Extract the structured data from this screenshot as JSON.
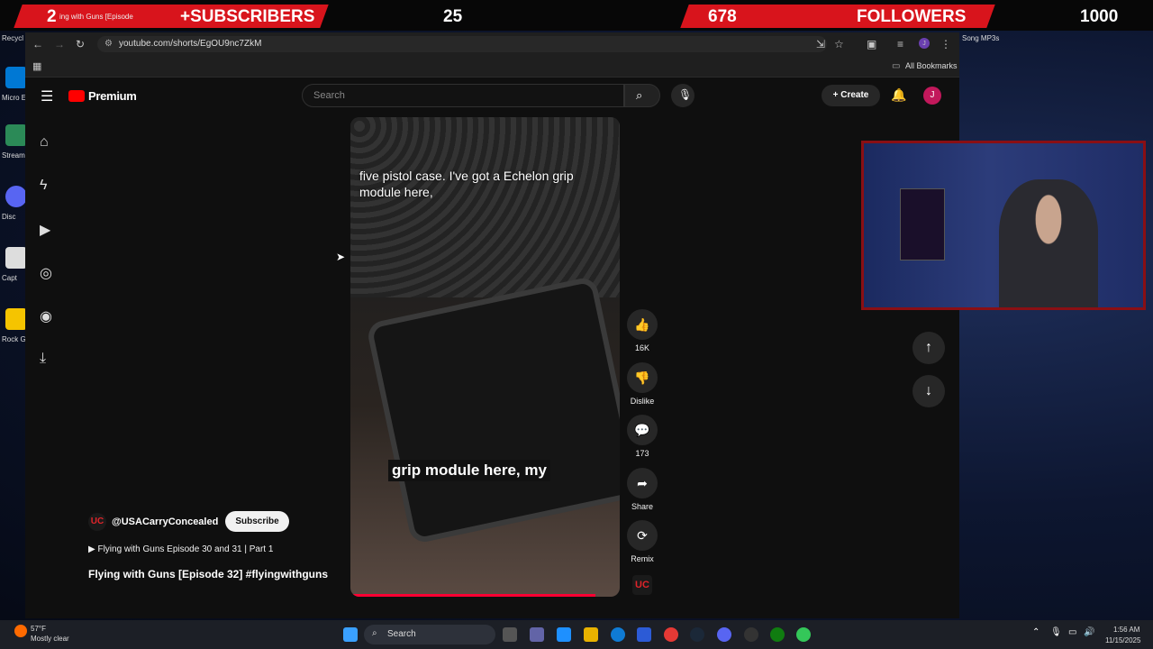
{
  "overlay": {
    "subs_prefix": "2",
    "subs_label": "+SUBSCRIBERS",
    "subs_count": "25",
    "followers_count": "678",
    "followers_label": "FOLLOWERS",
    "goal": "1000",
    "tab_title": "ing with Guns [Episode"
  },
  "desktop": {
    "icons": [
      "Recycl",
      "Micro Edg",
      "Stream Desk",
      "Disc",
      "Capt",
      "Rock Gam"
    ],
    "right_label": "Song MP3s"
  },
  "browser": {
    "url": "youtube.com/shorts/EgOU9nc7ZkM",
    "all_bookmarks": "All Bookmarks"
  },
  "youtube": {
    "logo": "Premium",
    "search_placeholder": "Search",
    "create_label": "Create",
    "avatar_letter": "J",
    "video": {
      "caption_top": "five pistol case. I've got a Echelon grip module here,",
      "caption_bottom": "grip module here, my"
    },
    "actions": {
      "like_count": "16K",
      "dislike": "Dislike",
      "comments_count": "173",
      "share": "Share",
      "remix": "Remix"
    },
    "channel": {
      "handle": "@USACarryConcealed",
      "subscribe": "Subscribe",
      "logo": "UC",
      "playlist": "Flying with Guns Episode 30 and 31 | Part 1",
      "title": "Flying with Guns [Episode 32] #flyingwithguns"
    }
  },
  "taskbar": {
    "weather_temp": "57°F",
    "weather_desc": "Mostly clear",
    "search": "Search",
    "time": "1:56 AM",
    "date": "11/15/2025"
  }
}
